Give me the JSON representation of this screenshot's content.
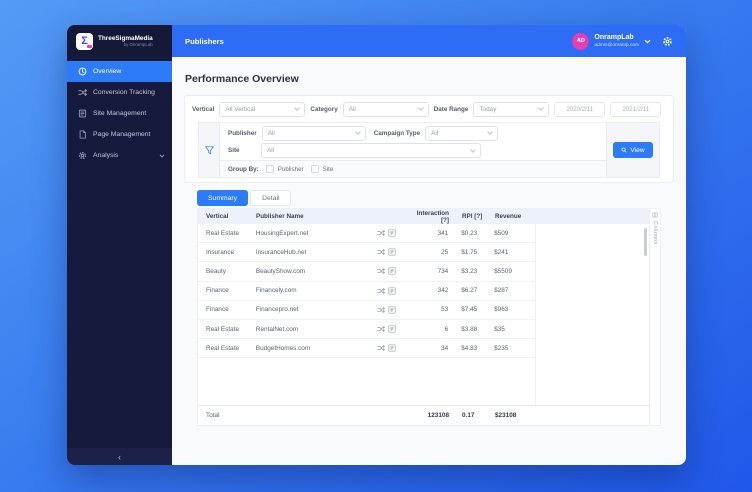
{
  "colors": {
    "accent": "#2d7bf6",
    "topbar": "#2f6cf6",
    "sidebar": "#161b3d",
    "avatar": "#e23fb1"
  },
  "brand": {
    "name": "ThreeSigmaMedia",
    "byline": "by OnrampLab"
  },
  "sidebar": {
    "items": [
      {
        "label": "Overview",
        "icon": "clock-icon",
        "active": true
      },
      {
        "label": "Conversion Tracking",
        "icon": "shuffle-icon",
        "active": false
      },
      {
        "label": "Site Management",
        "icon": "list-box-icon",
        "active": false
      },
      {
        "label": "Page Management",
        "icon": "page-icon",
        "active": false
      },
      {
        "label": "Analysis",
        "icon": "gear-icon",
        "active": false
      }
    ],
    "collapse": "‹"
  },
  "topbar": {
    "page_title": "Publishers",
    "account": {
      "initials": "AD",
      "name": "OnrampLab",
      "email": "admin@onramp.com"
    }
  },
  "page": {
    "title": "Performance Overview"
  },
  "filters": {
    "vertical": {
      "label": "Vertical",
      "value": "All Vertical"
    },
    "category": {
      "label": "Category",
      "value": "All"
    },
    "date_range": {
      "label": "Date Range",
      "value": "Today",
      "from": "2020/2/11",
      "to": "2021/2/11"
    },
    "publisher": {
      "label": "Publisher",
      "value": "All"
    },
    "campaign_type": {
      "label": "Campaign Type",
      "value": "All"
    },
    "site": {
      "label": "Site",
      "value": "All"
    },
    "group_by": {
      "label": "Group By:",
      "options": [
        "Publisher",
        "Site"
      ]
    },
    "view_button": "View"
  },
  "tabs": [
    {
      "label": "Summary",
      "active": true
    },
    {
      "label": "Detail",
      "active": false
    }
  ],
  "table": {
    "headers": {
      "vertical": "Vertical",
      "publisher": "Publisher Name",
      "interaction": "Interaction [?]",
      "rpi": "RPI [?]",
      "revenue": "Revenue"
    },
    "rows": [
      {
        "vertical": "Real Estate",
        "publisher": "HousingExpert.net",
        "interaction": "341",
        "rpi": "$0.23",
        "revenue": "$509"
      },
      {
        "vertical": "Insurance",
        "publisher": "InsuranceHub.net",
        "interaction": "25",
        "rpi": "$1.75",
        "revenue": "$241"
      },
      {
        "vertical": "Beauty",
        "publisher": "BeautyShow.com",
        "interaction": "734",
        "rpi": "$3.23",
        "revenue": "$5509"
      },
      {
        "vertical": "Finance",
        "publisher": "Financely.com",
        "interaction": "342",
        "rpi": "$6.27",
        "revenue": "$287"
      },
      {
        "vertical": "Finance",
        "publisher": "Financepro.net",
        "interaction": "53",
        "rpi": "$7.45",
        "revenue": "$963"
      },
      {
        "vertical": "Real Estate",
        "publisher": "RentalNet.com",
        "interaction": "6",
        "rpi": "$3.88",
        "revenue": "$35"
      },
      {
        "vertical": "Real Estate",
        "publisher": "BudgetHomes.com",
        "interaction": "34",
        "rpi": "$4.83",
        "revenue": "$235"
      }
    ],
    "total": {
      "label": "Total",
      "interaction": "123108",
      "rpi": "0.17",
      "revenue": "$23108"
    }
  },
  "side_panel": {
    "label": "Columns"
  },
  "logo_glyph": "Σ"
}
